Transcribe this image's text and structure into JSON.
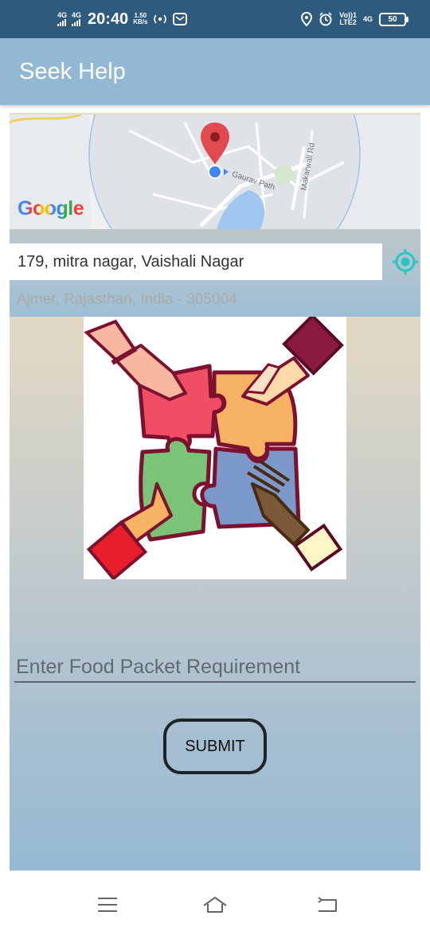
{
  "status_bar": {
    "network1": "4G",
    "network2": "4G",
    "time": "20:40",
    "speed_value": "1.50",
    "speed_unit": "KB/s",
    "volte_line1": "Vo))1",
    "volte_line2": "LTE2",
    "network3": "4G",
    "battery": "50"
  },
  "app_bar": {
    "title": "Seek Help"
  },
  "map": {
    "logo": "Google",
    "road1": "Gaurav Path",
    "road2": "Makarwali Rd"
  },
  "location": {
    "address_line1": "179, mitra nagar, Vaishali Nagar",
    "address_line2": "Ajmer, Rajasthan, India - 305004"
  },
  "form": {
    "placeholder": "Enter Food Packet Requirement",
    "submit_label": "SUBMIT"
  },
  "colors": {
    "status_bar": "#2e5a7e",
    "app_bar": "#93b8d3",
    "location_accent": "#26c6c6"
  },
  "icons": [
    "signal-icon",
    "hotspot-icon",
    "message-icon",
    "location-icon",
    "alarm-icon",
    "battery-icon",
    "map-pin-icon",
    "my-location-icon",
    "menu-icon",
    "home-icon",
    "back-icon"
  ]
}
